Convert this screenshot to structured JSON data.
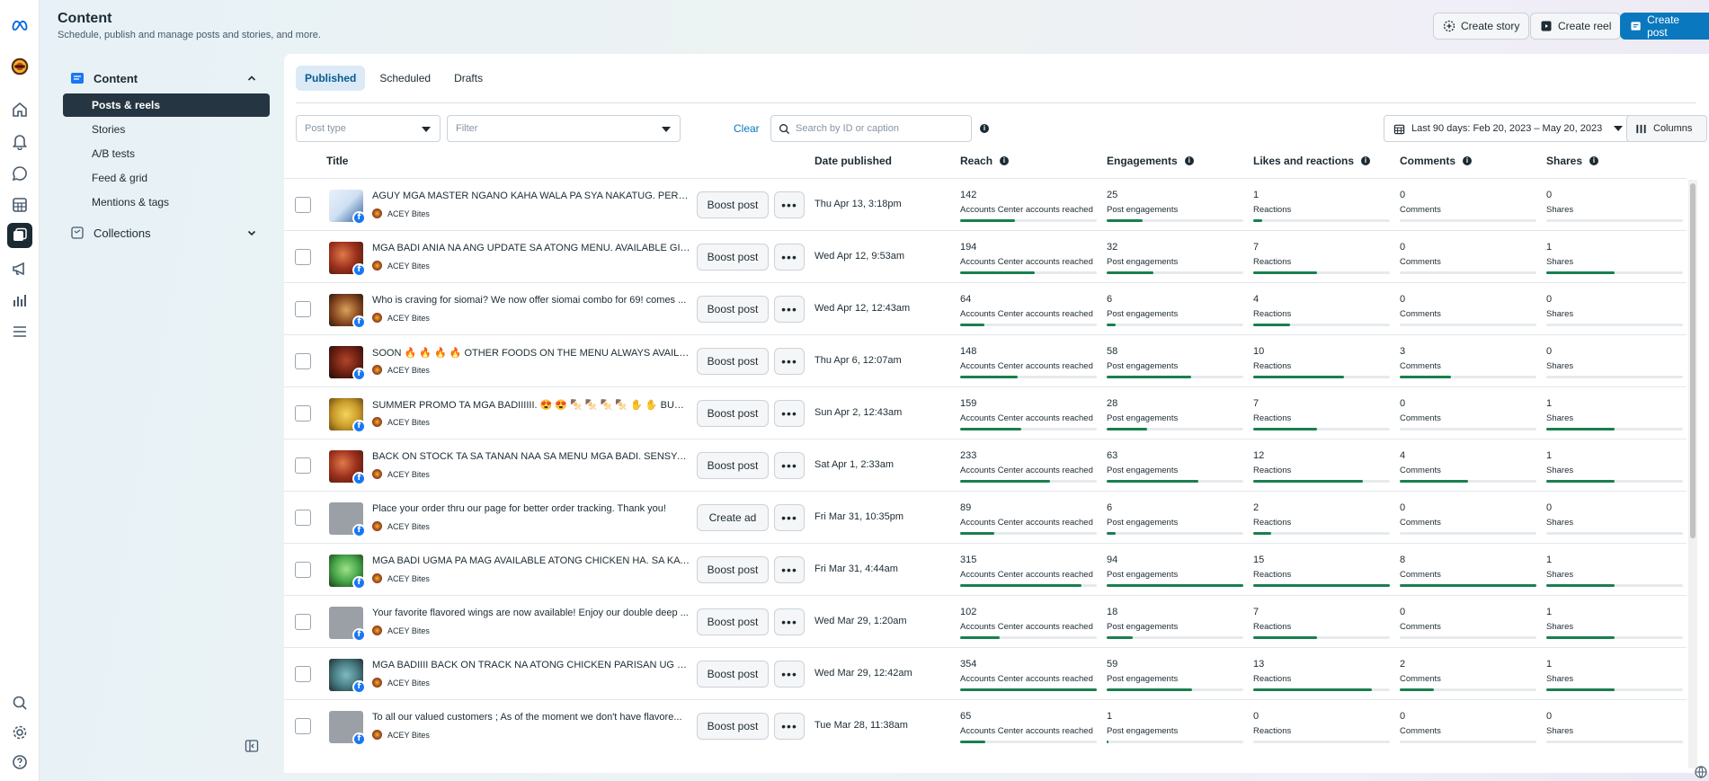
{
  "header": {
    "title": "Content",
    "subtitle": "Schedule, publish and manage posts and stories, and more.",
    "create_story_label": "Create story",
    "create_reel_label": "Create reel",
    "create_post_label": "Create post"
  },
  "nav": {
    "content_label": "Content",
    "items": [
      "Posts & reels",
      "Stories",
      "A/B tests",
      "Feed & grid",
      "Mentions & tags"
    ],
    "collections_label": "Collections"
  },
  "tabs": [
    "Published",
    "Scheduled",
    "Drafts"
  ],
  "filters": {
    "post_type_placeholder": "Post type",
    "filter_placeholder": "Filter",
    "clear_label": "Clear",
    "search_placeholder": "Search by ID or caption",
    "date_range_label": "Last 90 days: Feb 20, 2023 – May 20, 2023",
    "columns_label": "Columns"
  },
  "table": {
    "headers": [
      "Title",
      "Date published",
      "Reach",
      "Engagements",
      "Likes and reactions",
      "Comments",
      "Shares"
    ],
    "metric_labels": {
      "reach": "Accounts Center accounts reached",
      "engagements": "Post engagements",
      "reactions": "Reactions",
      "comments": "Comments",
      "shares": "Shares"
    },
    "page_name": "ACEY Bites",
    "rows": [
      {
        "caption": "AGUY MGA MASTER NGANO KAHA WALA PA SYA NAKATUG. PERO C...",
        "action": "Boost post",
        "date": "Thu Apr 13, 3:18pm",
        "reach": "142",
        "engagements": "25",
        "reactions": "1",
        "comments": "0",
        "shares": "0",
        "thumb": "graphic"
      },
      {
        "caption": "MGA BADI ANIA NA ANG UPDATE SA ATONG MENU. AVAILABLE GIHA...",
        "action": "Boost post",
        "date": "Wed Apr 12, 9:53am",
        "reach": "194",
        "engagements": "32",
        "reactions": "7",
        "comments": "0",
        "shares": "1",
        "thumb": "food-red"
      },
      {
        "caption": "Who is craving for siomai? We now offer siomai combo for 69! comes ...",
        "action": "Boost post",
        "date": "Wed Apr 12, 12:43am",
        "reach": "64",
        "engagements": "6",
        "reactions": "4",
        "comments": "0",
        "shares": "0",
        "thumb": "food-brown"
      },
      {
        "caption": "SOON 🔥 🔥 🔥 🔥 OTHER FOODS ON THE MENU ALWAYS AVAILABLE...",
        "action": "Boost post",
        "date": "Thu Apr 6, 12:07am",
        "reach": "148",
        "engagements": "58",
        "reactions": "10",
        "comments": "3",
        "shares": "0",
        "thumb": "food-dark"
      },
      {
        "caption": "SUMMER PROMO TA MGA BADIIIIII. 😍 😍 🍢 🍢 🍢 🍢 ✋ ✋ BUY 2 F...",
        "action": "Boost post",
        "date": "Sun Apr 2, 12:43am",
        "reach": "159",
        "engagements": "28",
        "reactions": "7",
        "comments": "0",
        "shares": "1",
        "thumb": "food-yellow"
      },
      {
        "caption": "BACK ON STOCK TA SA TANAN NAA SA MENU MGA BADI. SENSYA SA...",
        "action": "Boost post",
        "date": "Sat Apr 1, 2:33am",
        "reach": "233",
        "engagements": "63",
        "reactions": "12",
        "comments": "4",
        "shares": "1",
        "thumb": "food-red"
      },
      {
        "caption": "Place your order thru our page for better order tracking. Thank you!",
        "action": "Create ad",
        "date": "Fri Mar 31, 10:35pm",
        "reach": "89",
        "engagements": "6",
        "reactions": "2",
        "comments": "0",
        "shares": "0",
        "thumb": "placeholder"
      },
      {
        "caption": "MGA BADI UGMA PA MAG AVAILABLE ATONG CHICKEN HA. SA KA KU...",
        "action": "Boost post",
        "date": "Fri Mar 31, 4:44am",
        "reach": "315",
        "engagements": "94",
        "reactions": "15",
        "comments": "8",
        "shares": "1",
        "thumb": "food-green"
      },
      {
        "caption": "Your favorite flavored wings are now available! Enjoy our double deep ...",
        "action": "Boost post",
        "date": "Wed Mar 29, 1:20am",
        "reach": "102",
        "engagements": "18",
        "reactions": "7",
        "comments": "0",
        "shares": "1",
        "thumb": "placeholder"
      },
      {
        "caption": "MGA BADIIII BACK ON TRACK NA ATONG CHICKEN PARISAN UG SISI...",
        "action": "Boost post",
        "date": "Wed Mar 29, 12:42am",
        "reach": "354",
        "engagements": "59",
        "reactions": "13",
        "comments": "2",
        "shares": "1",
        "thumb": "food-teal"
      },
      {
        "caption": "To all our valued customers ; As of the moment we don't have flavore...",
        "action": "Boost post",
        "date": "Tue Mar 28, 11:38am",
        "reach": "65",
        "engagements": "1",
        "reactions": "0",
        "comments": "0",
        "shares": "0",
        "thumb": "placeholder"
      }
    ]
  },
  "colors": {
    "accent": "#0a78be",
    "bar_fill": "#1a7f4f",
    "nav_active": "#253642"
  }
}
